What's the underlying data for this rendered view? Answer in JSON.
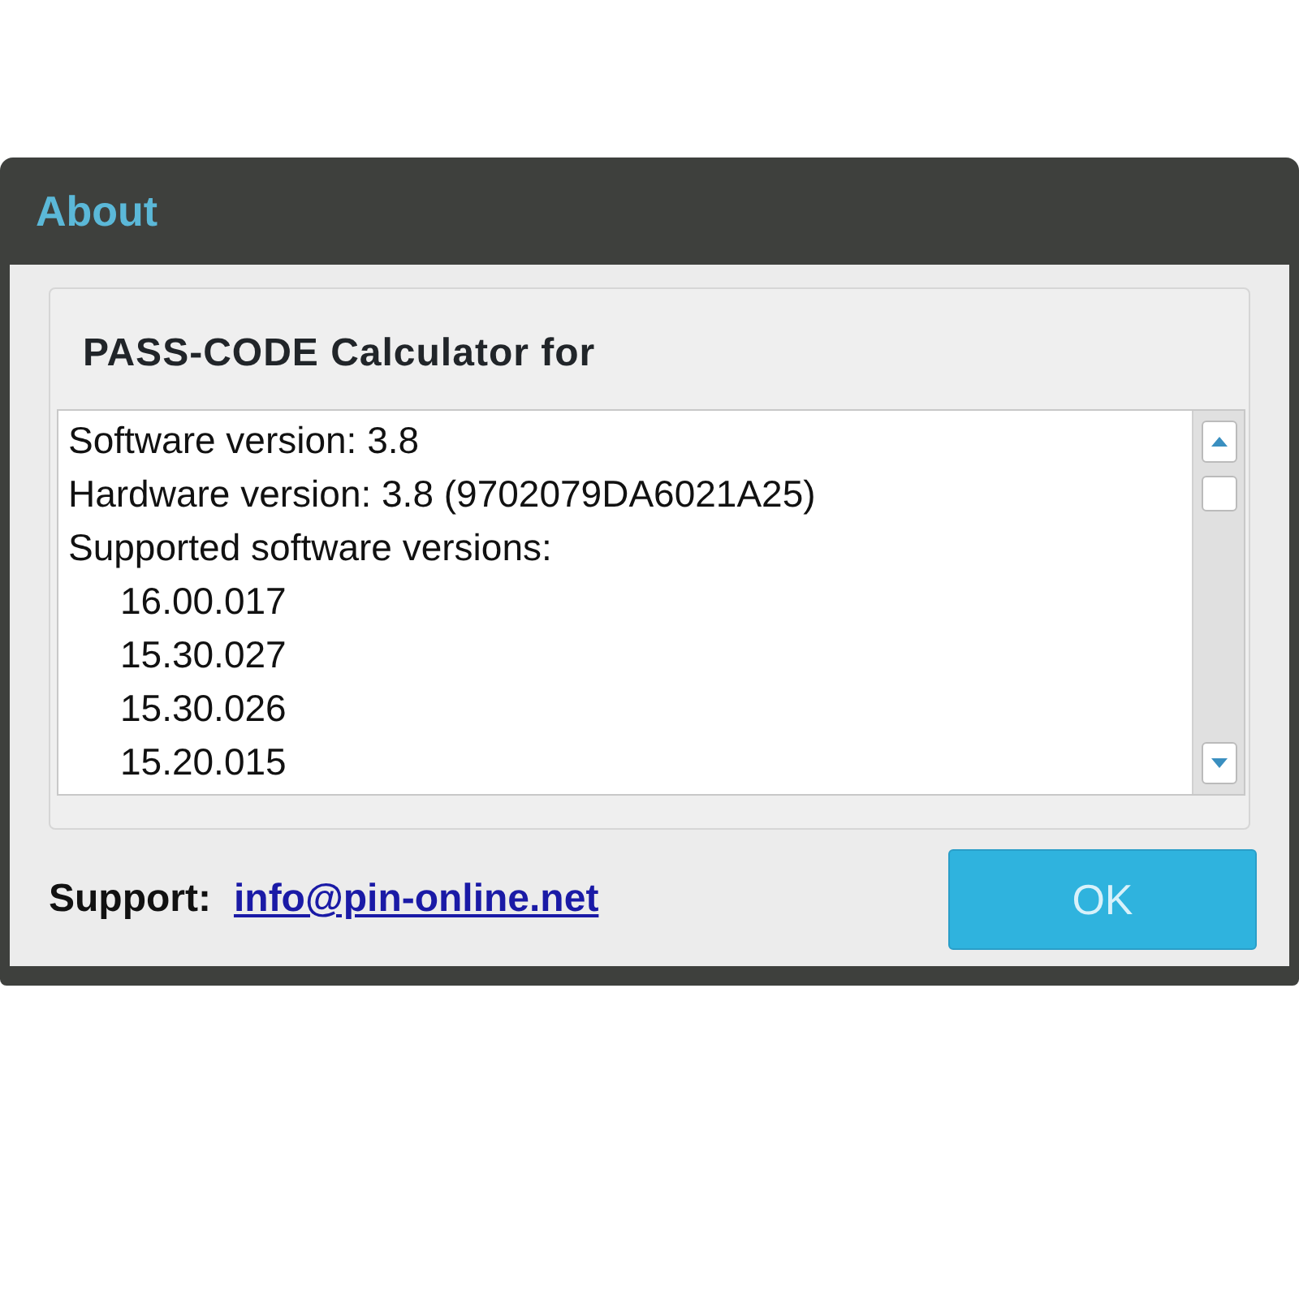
{
  "window": {
    "title": "About"
  },
  "heading": "PASS-CODE Calculator for",
  "info_lines": [
    {
      "text": "Software version: 3.8"
    },
    {
      "text": "Hardware version: 3.8 (9702079DA6021A25)"
    },
    {
      "text": "Supported software versions:",
      "children": [
        {
          "text": "16.00.017"
        },
        {
          "text": "15.30.027"
        },
        {
          "text": "15.30.026"
        },
        {
          "text": "15.20.015"
        }
      ]
    }
  ],
  "support": {
    "label": "Support:",
    "link": "info@pin-online.net"
  },
  "buttons": [
    "OK"
  ]
}
